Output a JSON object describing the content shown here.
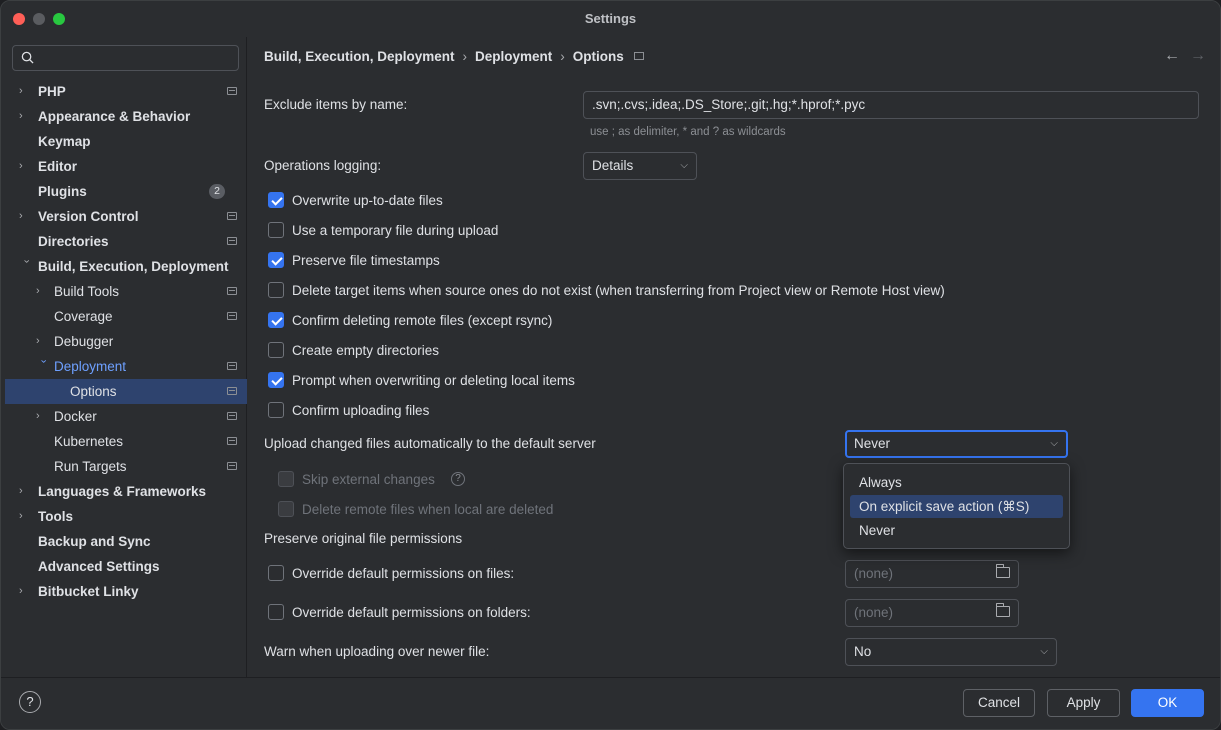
{
  "window": {
    "title": "Settings"
  },
  "sidebar": {
    "search_placeholder": "",
    "items": [
      {
        "label": "PHP"
      },
      {
        "label": "Appearance & Behavior"
      },
      {
        "label": "Keymap"
      },
      {
        "label": "Editor"
      },
      {
        "label": "Plugins",
        "badge": "2"
      },
      {
        "label": "Version Control"
      },
      {
        "label": "Directories"
      },
      {
        "label": "Build, Execution, Deployment"
      },
      {
        "label": "Build Tools"
      },
      {
        "label": "Coverage"
      },
      {
        "label": "Debugger"
      },
      {
        "label": "Deployment"
      },
      {
        "label": "Options"
      },
      {
        "label": "Docker"
      },
      {
        "label": "Kubernetes"
      },
      {
        "label": "Run Targets"
      },
      {
        "label": "Languages & Frameworks"
      },
      {
        "label": "Tools"
      },
      {
        "label": "Backup and Sync"
      },
      {
        "label": "Advanced Settings"
      },
      {
        "label": "Bitbucket Linky"
      }
    ]
  },
  "breadcrumb": {
    "items": [
      "Build, Execution, Deployment",
      "Deployment",
      "Options"
    ],
    "sep": "›"
  },
  "main": {
    "exclude": {
      "label": "Exclude items by name:",
      "value": ".svn;.cvs;.idea;.DS_Store;.git;.hg;*.hprof;*.pyc",
      "hint": "use ; as delimiter, * and ? as wildcards"
    },
    "logging": {
      "label": "Operations logging:",
      "value": "Details"
    },
    "checkboxes": [
      {
        "label": "Overwrite up-to-date files",
        "checked": true
      },
      {
        "label": "Use a temporary file during upload",
        "checked": false
      },
      {
        "label": "Preserve file timestamps",
        "checked": true
      },
      {
        "label": "Delete target items when source ones do not exist (when transferring from Project view or Remote Host view)",
        "checked": false
      },
      {
        "label": "Confirm deleting remote files (except rsync)",
        "checked": true
      },
      {
        "label": "Create empty directories",
        "checked": false
      },
      {
        "label": "Prompt when overwriting or deleting local items",
        "checked": true
      },
      {
        "label": "Confirm uploading files",
        "checked": false
      }
    ],
    "upload_auto": {
      "label": "Upload changed files automatically to the default server",
      "value": "Never"
    },
    "skip_external": {
      "label": "Skip external changes",
      "help": "?"
    },
    "delete_remote": {
      "label": "Delete remote files when local are deleted"
    },
    "preserve_perms": {
      "label": "Preserve original file permissions"
    },
    "override_files": {
      "label": "Override default permissions on files:",
      "placeholder": "(none)"
    },
    "override_folders": {
      "label": "Override default permissions on folders:",
      "placeholder": "(none)"
    },
    "warn_newer": {
      "label": "Warn when uploading over newer file:",
      "value": "No"
    }
  },
  "popup": {
    "options": [
      "Always",
      "On explicit save action (⌘S)",
      "Never"
    ],
    "highlighted": "On explicit save action (⌘S)"
  },
  "footer": {
    "help": "?",
    "cancel": "Cancel",
    "apply": "Apply",
    "ok": "OK"
  },
  "colors": {
    "accent": "#3574f0",
    "selection": "#2e436e",
    "background": "#2b2d30"
  }
}
